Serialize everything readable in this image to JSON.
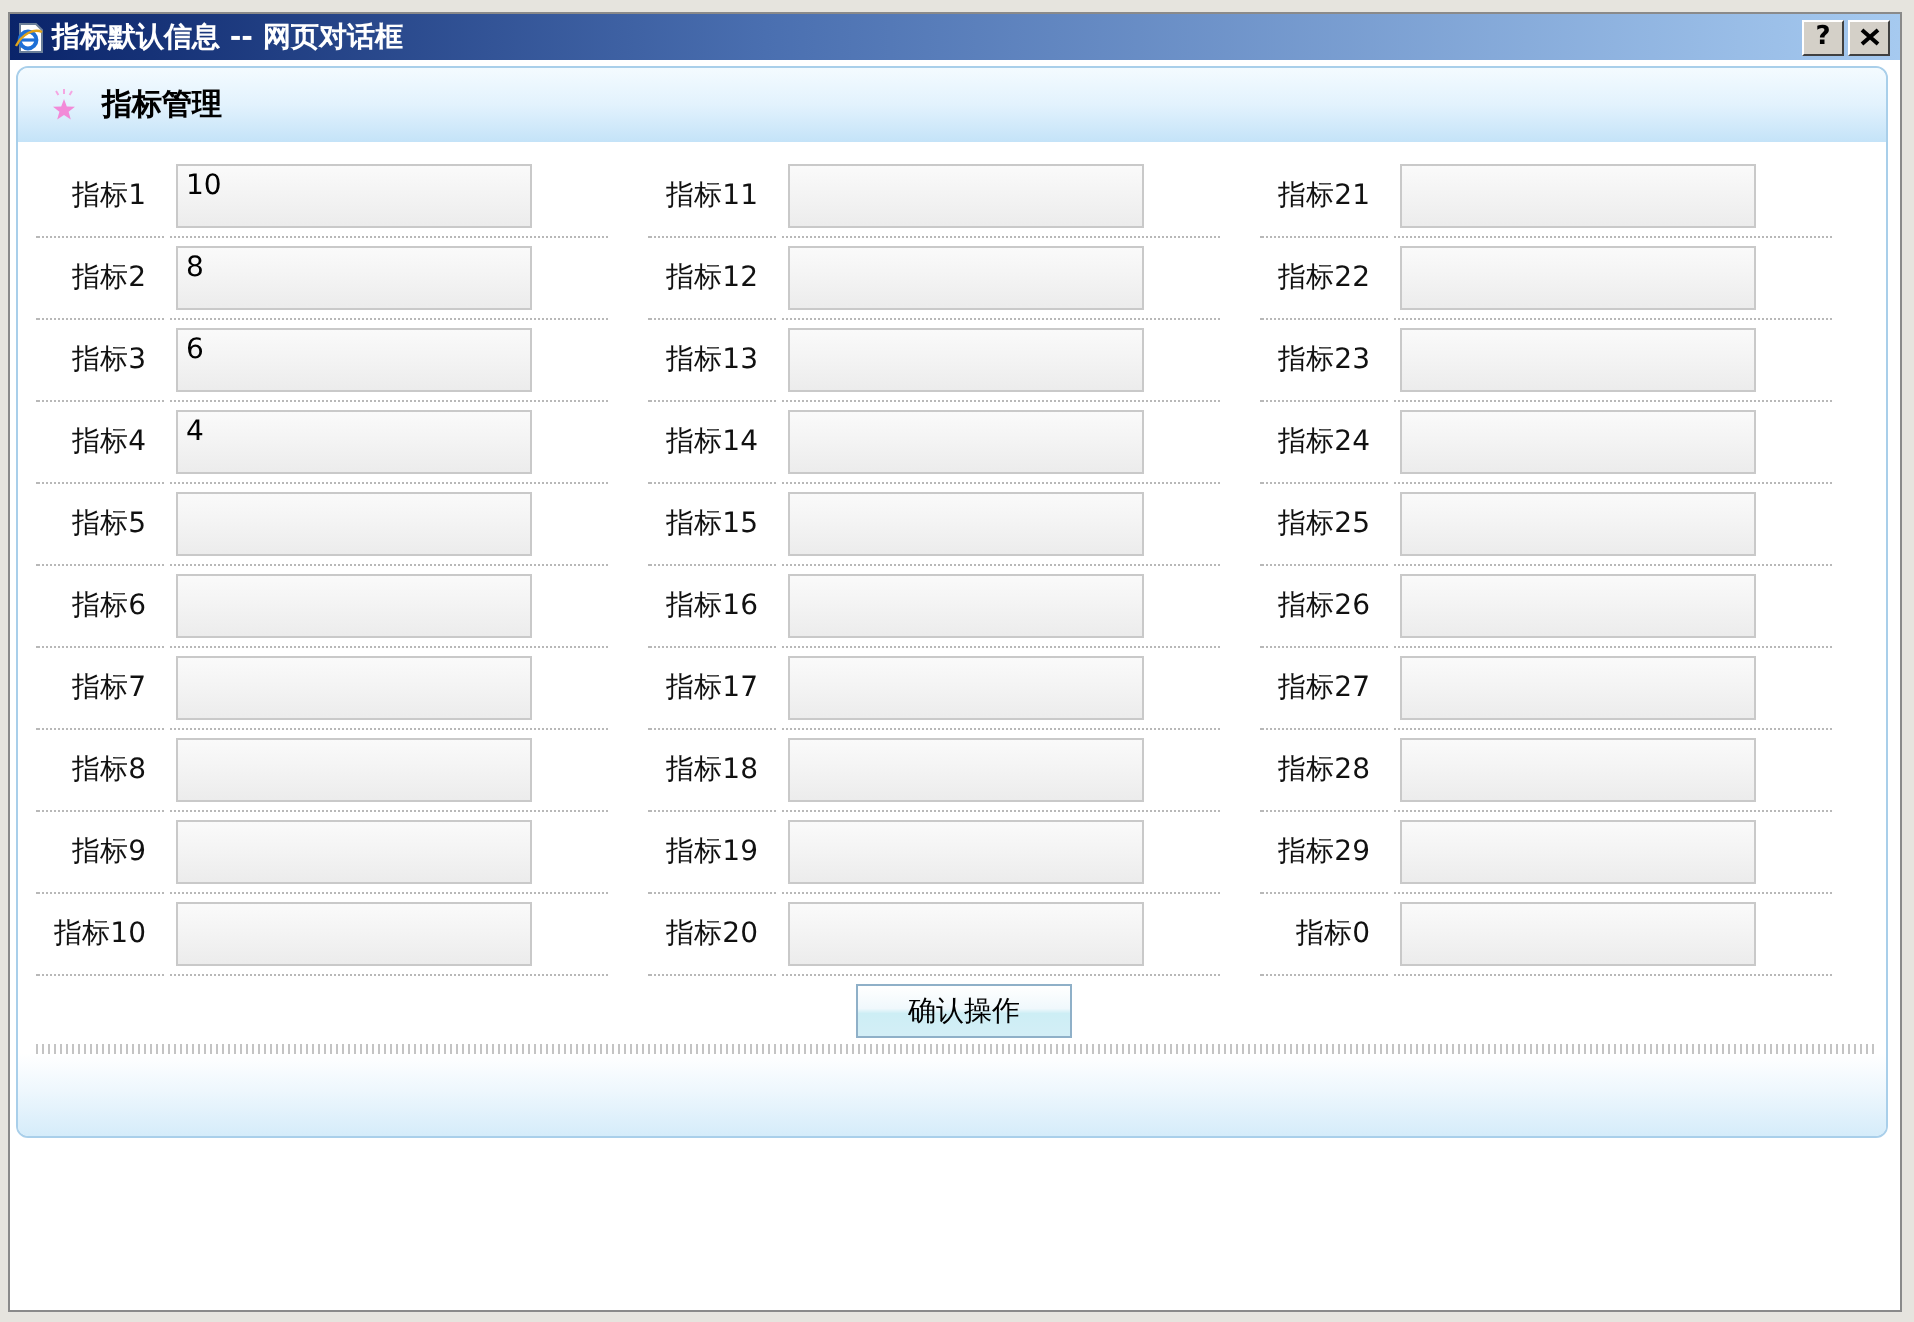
{
  "window": {
    "title": "指标默认信息 -- 网页对话框",
    "help_button": "?"
  },
  "panel": {
    "title": "指标管理"
  },
  "rows": [
    {
      "items": [
        {
          "label": "指标1",
          "value": "10"
        },
        {
          "label": "指标11"
        },
        {
          "label": "指标21"
        }
      ]
    },
    {
      "items": [
        {
          "label": "指标2",
          "value": "8"
        },
        {
          "label": "指标12"
        },
        {
          "label": "指标22"
        }
      ]
    },
    {
      "items": [
        {
          "label": "指标3",
          "value": "6"
        },
        {
          "label": "指标13"
        },
        {
          "label": "指标23"
        }
      ]
    },
    {
      "items": [
        {
          "label": "指标4",
          "value": "4"
        },
        {
          "label": "指标14"
        },
        {
          "label": "指标24"
        }
      ]
    },
    {
      "items": [
        {
          "label": "指标5"
        },
        {
          "label": "指标15"
        },
        {
          "label": "指标25"
        }
      ]
    },
    {
      "items": [
        {
          "label": "指标6"
        },
        {
          "label": "指标16"
        },
        {
          "label": "指标26"
        }
      ]
    },
    {
      "items": [
        {
          "label": "指标7"
        },
        {
          "label": "指标17"
        },
        {
          "label": "指标27"
        }
      ]
    },
    {
      "items": [
        {
          "label": "指标8"
        },
        {
          "label": "指标18"
        },
        {
          "label": "指标28"
        }
      ]
    },
    {
      "items": [
        {
          "label": "指标9"
        },
        {
          "label": "指标19"
        },
        {
          "label": "指标29"
        }
      ]
    },
    {
      "items": [
        {
          "label": "指标10"
        },
        {
          "label": "指标20"
        },
        {
          "label": "指标0"
        }
      ]
    }
  ],
  "confirm_button": "确认操作"
}
